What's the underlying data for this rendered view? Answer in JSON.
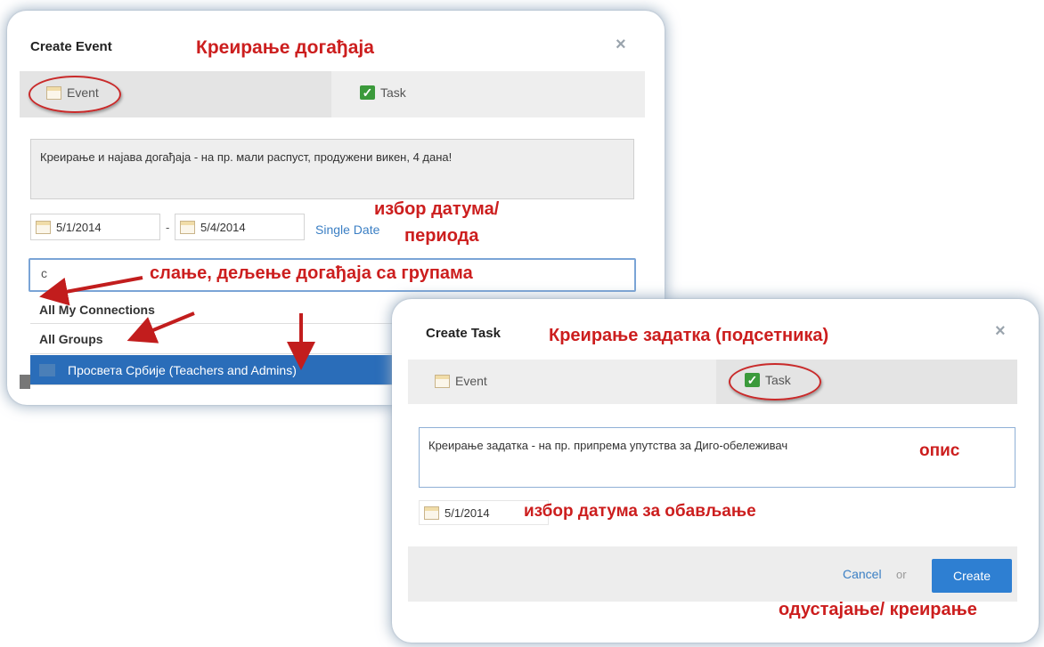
{
  "event_dialog": {
    "title": "Create Event",
    "close_glyph": "×",
    "annotation_title": "Креирање догађаја",
    "tabs": {
      "event_label": "Event",
      "task_label": "Task"
    },
    "description": "Креирање и најава догађаја  - на пр. мали распуст, продужени викен, 4 дана!",
    "start_date": "5/1/2014",
    "date_separator": "-",
    "end_date": "5/4/2014",
    "single_date_link": "Single Date",
    "annotation_dates_line1": "избор датума/",
    "annotation_dates_line2": "периода",
    "share_input_value": "c",
    "annotation_share": "слање, дељење догађаја са групама",
    "dropdown_items": [
      "All My Connections",
      "All Groups",
      "Просвета Србије (Teachers and Admins)"
    ]
  },
  "task_dialog": {
    "title": "Create Task",
    "close_glyph": "×",
    "annotation_title": "Креирање задатка (подсетника)",
    "tabs": {
      "event_label": "Event",
      "task_label": "Task"
    },
    "description": "Креирање задатка - на пр. припрема упутства за Диго-обележивач",
    "annotation_description": "опис",
    "due_date": "5/1/2014",
    "annotation_date": "избор датума за обављање",
    "cancel_label": "Cancel",
    "or_label": "or",
    "create_label": "Create",
    "annotation_buttons": "одустајање/ креирање"
  },
  "colors": {
    "annotation": "#cc1e1e",
    "accent": "#2e7fd2",
    "selected_row": "#2a6db9"
  },
  "icons": [
    "calendar-icon",
    "checkbox-checked-icon",
    "close-icon"
  ]
}
